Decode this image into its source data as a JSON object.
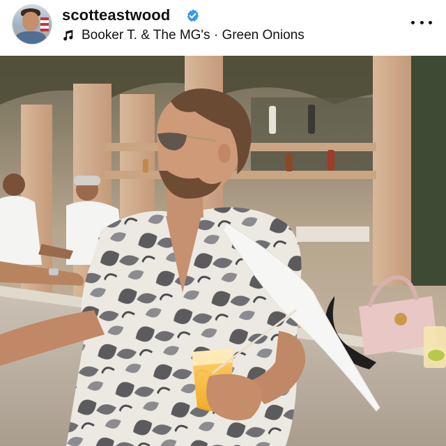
{
  "post": {
    "username": "scotteastwood",
    "verified": true,
    "audio": "Booker T. & The MG's · Green Onions",
    "icons": {
      "avatar": "profile-photo",
      "verified": "verified-badge-icon",
      "audio": "music-note-icon",
      "more": "more-options-icon"
    },
    "colors": {
      "verified_blue": "#3897f0",
      "text": "#111111"
    }
  }
}
